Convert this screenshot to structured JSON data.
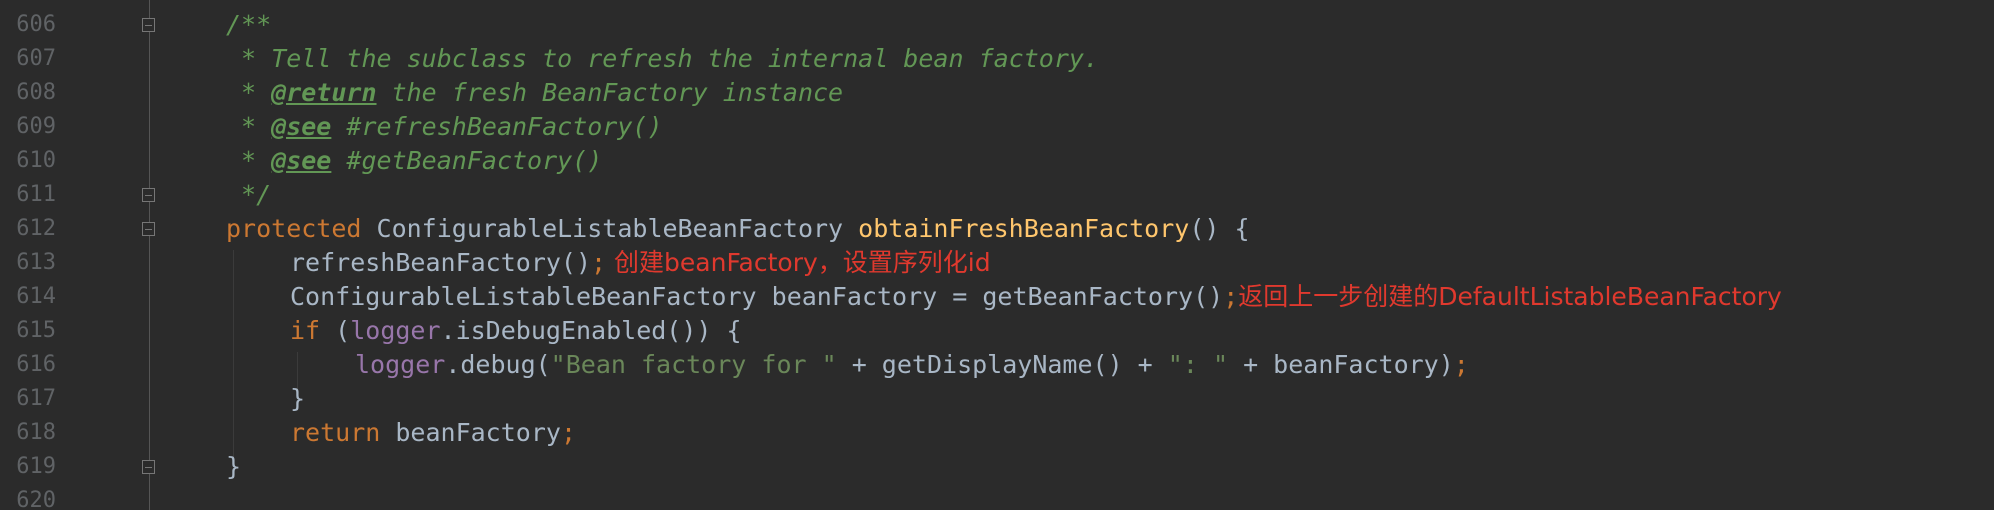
{
  "editor": {
    "lines": [
      {
        "number": "606",
        "tokens": [
          {
            "text": "/**",
            "type": "comment"
          }
        ]
      },
      {
        "number": "607",
        "tokens": [
          {
            "text": " * Tell the subclass to refresh the internal bean factory.",
            "type": "comment"
          }
        ]
      },
      {
        "number": "608",
        "tokens": [
          {
            "text": " * ",
            "type": "comment"
          },
          {
            "text": "@return",
            "type": "comment-tag"
          },
          {
            "text": " the fresh BeanFactory instance",
            "type": "comment"
          }
        ]
      },
      {
        "number": "609",
        "tokens": [
          {
            "text": " * ",
            "type": "comment"
          },
          {
            "text": "@see",
            "type": "comment-tag"
          },
          {
            "text": " #refreshBeanFactory()",
            "type": "comment"
          }
        ]
      },
      {
        "number": "610",
        "tokens": [
          {
            "text": " * ",
            "type": "comment"
          },
          {
            "text": "@see",
            "type": "comment-tag"
          },
          {
            "text": " #getBeanFactory()",
            "type": "comment"
          }
        ]
      },
      {
        "number": "611",
        "tokens": [
          {
            "text": " */",
            "type": "comment"
          }
        ]
      },
      {
        "number": "612",
        "tokens": [
          {
            "text": "protected",
            "type": "keyword"
          },
          {
            "text": " ConfigurableListableBeanFactory ",
            "type": "plain"
          },
          {
            "text": "obtainFreshBeanFactory",
            "type": "method"
          },
          {
            "text": "() {",
            "type": "plain"
          }
        ]
      },
      {
        "number": "613",
        "tokens": [
          {
            "text": "refreshBeanFactory()",
            "type": "plain"
          },
          {
            "text": ";",
            "type": "punct"
          },
          {
            "text": " 创建beanFactory，设置序列化id",
            "type": "note"
          }
        ]
      },
      {
        "number": "614",
        "tokens": [
          {
            "text": "ConfigurableListableBeanFactory beanFactory = getBeanFactory()",
            "type": "plain"
          },
          {
            "text": ";",
            "type": "punct"
          },
          {
            "text": "返回上一步创建的DefaultListableBeanFactory",
            "type": "note"
          }
        ]
      },
      {
        "number": "615",
        "tokens": [
          {
            "text": "if",
            "type": "keyword"
          },
          {
            "text": " (",
            "type": "plain"
          },
          {
            "text": "logger",
            "type": "field"
          },
          {
            "text": ".isDebugEnabled()) {",
            "type": "plain"
          }
        ]
      },
      {
        "number": "616",
        "tokens": [
          {
            "text": "logger",
            "type": "field"
          },
          {
            "text": ".debug(",
            "type": "plain"
          },
          {
            "text": "\"Bean factory for \"",
            "type": "string"
          },
          {
            "text": " + getDisplayName() + ",
            "type": "plain"
          },
          {
            "text": "\": \"",
            "type": "string"
          },
          {
            "text": " + beanFactory)",
            "type": "plain"
          },
          {
            "text": ";",
            "type": "punct"
          }
        ]
      },
      {
        "number": "617",
        "tokens": [
          {
            "text": "}",
            "type": "plain"
          }
        ]
      },
      {
        "number": "618",
        "tokens": [
          {
            "text": "return",
            "type": "keyword"
          },
          {
            "text": " beanFactory",
            "type": "plain"
          },
          {
            "text": ";",
            "type": "punct"
          }
        ]
      },
      {
        "number": "619",
        "tokens": [
          {
            "text": "}",
            "type": "plain"
          }
        ]
      },
      {
        "number": "620",
        "tokens": []
      }
    ]
  },
  "colors": {
    "background": "#2b2b2b",
    "line_number": "#606366",
    "plain": "#a9b7c6",
    "keyword": "#cc7832",
    "method": "#ffc66d",
    "comment": "#629755",
    "string": "#6a8759",
    "field": "#9876aa",
    "annotation": "#e0392e"
  }
}
